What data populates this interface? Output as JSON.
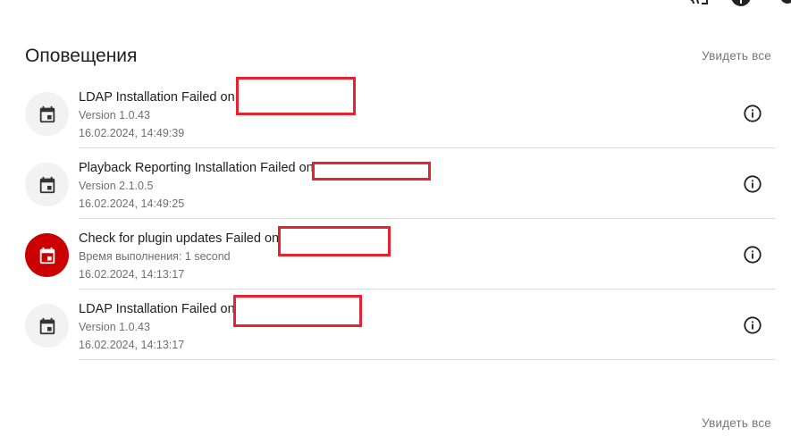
{
  "notifications": {
    "title": "Оповещения",
    "see_all_label": "Увидеть все",
    "items": [
      {
        "title": "LDAP Installation Failed on",
        "subtitle": "Version 1.0.43",
        "timestamp": "16.02.2024, 14:49:39",
        "icon": "calendar-icon",
        "severity": "normal"
      },
      {
        "title": "Playback Reporting Installation Failed on",
        "subtitle": "Version 2.1.0.5",
        "timestamp": "16.02.2024, 14:49:25",
        "icon": "calendar-icon",
        "severity": "normal"
      },
      {
        "title": "Check for plugin updates Failed on",
        "subtitle": "Время выполнения: 1 second",
        "timestamp": "16.02.2024, 14:13:17",
        "icon": "calendar-icon",
        "severity": "error"
      },
      {
        "title": "LDAP Installation Failed on",
        "subtitle": "Version 1.0.43",
        "timestamp": "16.02.2024, 14:13:17",
        "icon": "calendar-icon",
        "severity": "normal"
      }
    ]
  },
  "colors": {
    "error_accent": "#cc0000",
    "redaction": "#e8232f"
  }
}
